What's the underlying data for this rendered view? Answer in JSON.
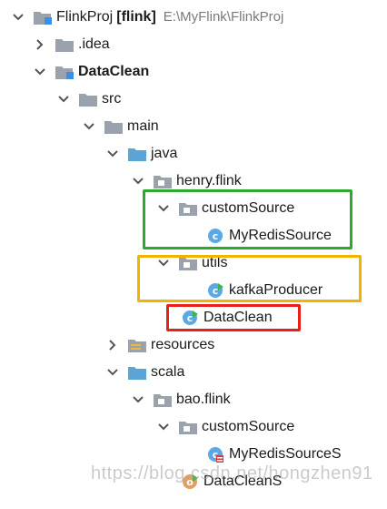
{
  "tree": {
    "project": {
      "name": "FlinkProj",
      "module_tag": "[flink]",
      "path": "E:\\MyFlink\\FlinkProj"
    },
    "idea": ".idea",
    "dataclean_module": "DataClean",
    "src": "src",
    "main": "main",
    "java": "java",
    "henry_flink": "henry.flink",
    "custom_source": "customSource",
    "my_redis_source": "MyRedisSource",
    "utils": "utils",
    "kafka_producer": "kafkaProducer",
    "dataclean_class": "DataClean",
    "resources": "resources",
    "scala": "scala",
    "bao_flink": "bao.flink",
    "custom_source_scala": "customSource",
    "my_redis_source_s": "MyRedisSourceS",
    "dataclean_s": "DataCleanS"
  },
  "highlight_colors": {
    "green": "#2ea82e",
    "orange": "#f0b400",
    "red": "#e8201a"
  },
  "icon_colors": {
    "folder_gray": "#9aa3ad",
    "folder_blue": "#5ba4d8",
    "class_circle": "#5aa9e6",
    "scala_object": "#e0a060"
  },
  "watermark": "https://blog.csdn.net/hongzhen91"
}
